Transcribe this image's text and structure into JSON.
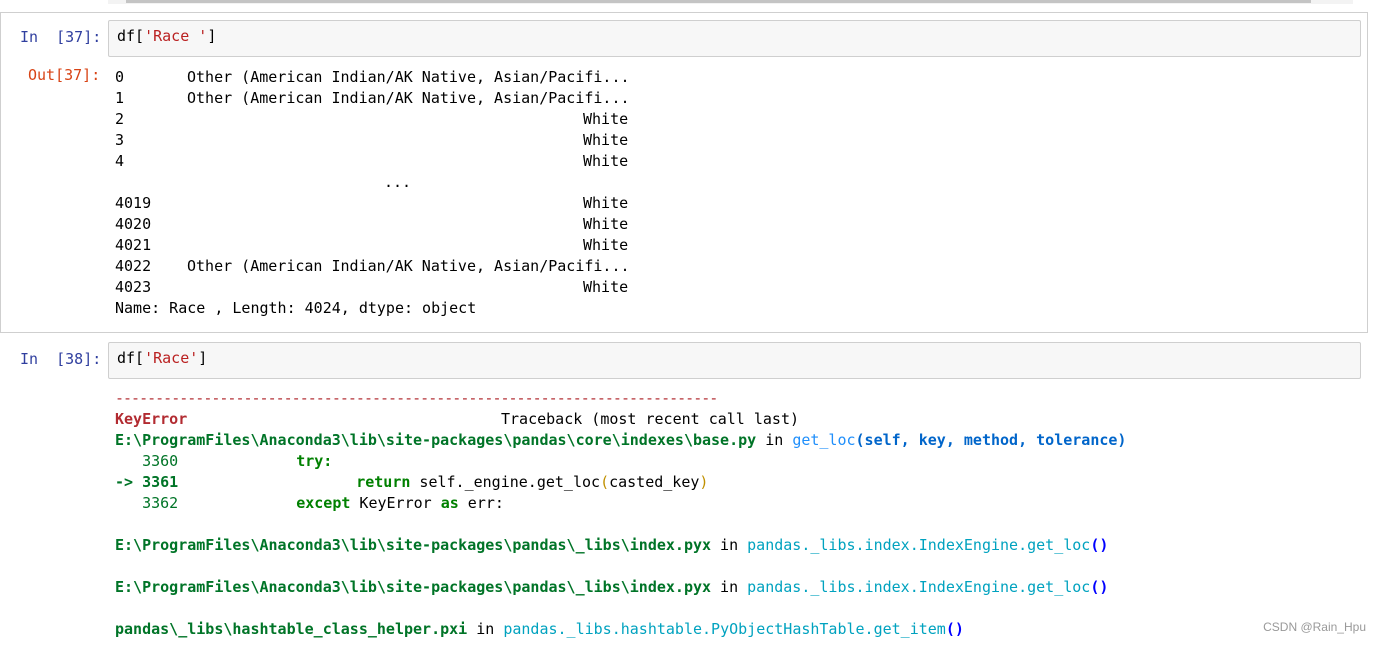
{
  "cell37": {
    "prompt_in": "In  [37]:",
    "prompt_out": "Out[37]:",
    "code_prefix": "df[",
    "code_string": "'Race '",
    "code_suffix": "]",
    "rows": [
      {
        "index": "0",
        "value": "Other (American Indian/AK Native, Asian/Pacifi..."
      },
      {
        "index": "1",
        "value": "Other (American Indian/AK Native, Asian/Pacifi..."
      },
      {
        "index": "2",
        "value": "White"
      },
      {
        "index": "3",
        "value": "White"
      },
      {
        "index": "4",
        "value": "White"
      },
      {
        "index": "",
        "value": "..."
      },
      {
        "index": "4019",
        "value": "White"
      },
      {
        "index": "4020",
        "value": "White"
      },
      {
        "index": "4021",
        "value": "White"
      },
      {
        "index": "4022",
        "value": "Other (American Indian/AK Native, Asian/Pacifi..."
      },
      {
        "index": "4023",
        "value": "White"
      }
    ],
    "footer": "Name: Race , Length: 4024, dtype: object"
  },
  "cell38": {
    "prompt_in": "In  [38]:",
    "code_prefix": "df[",
    "code_string": "'Race'",
    "code_suffix": "]",
    "traceback": {
      "separator": "---------------------------------------------------------------------------",
      "error_name": "KeyError",
      "header_right": "Traceback (most recent call last)",
      "frame1": {
        "path": "E:\\ProgramFiles\\Anaconda3\\lib\\site-packages\\pandas\\core\\indexes\\base.py",
        "in_word": " in ",
        "func": "get_loc",
        "args": "(self, key, method, tolerance)",
        "l1_no": "   3360",
        "l1_code": "try:",
        "l2_arrow": "-> 3361",
        "l2_kw": "return",
        "l2_code": " self._engine.get_loc",
        "l2_open": "(",
        "l2_arg": "casted_key",
        "l2_close": ")",
        "l3_no": "   3362",
        "l3_kw": "except",
        "l3_code": " KeyError ",
        "l3_kw2": "as",
        "l3_rest": " err:"
      },
      "frame2": {
        "path": "E:\\ProgramFiles\\Anaconda3\\lib\\site-packages\\pandas\\_libs\\index.pyx",
        "in_word": " in ",
        "func": "pandas._libs.index.IndexEngine.get_loc",
        "args": "()"
      },
      "frame3": {
        "path": "E:\\ProgramFiles\\Anaconda3\\lib\\site-packages\\pandas\\_libs\\index.pyx",
        "in_word": " in ",
        "func": "pandas._libs.index.IndexEngine.get_loc",
        "args": "()"
      },
      "frame4": {
        "path": "pandas\\_libs\\hashtable_class_helper.pxi",
        "in_word": " in ",
        "func": "pandas._libs.hashtable.PyObjectHashTable.get_item",
        "args": "()"
      }
    }
  },
  "watermark": "CSDN @Rain_Hpu",
  "colors": {
    "prompt_in": "#303f9f",
    "prompt_out": "#d84315",
    "error": "#b22b31",
    "path": "#007427",
    "function": "#208ffb"
  }
}
